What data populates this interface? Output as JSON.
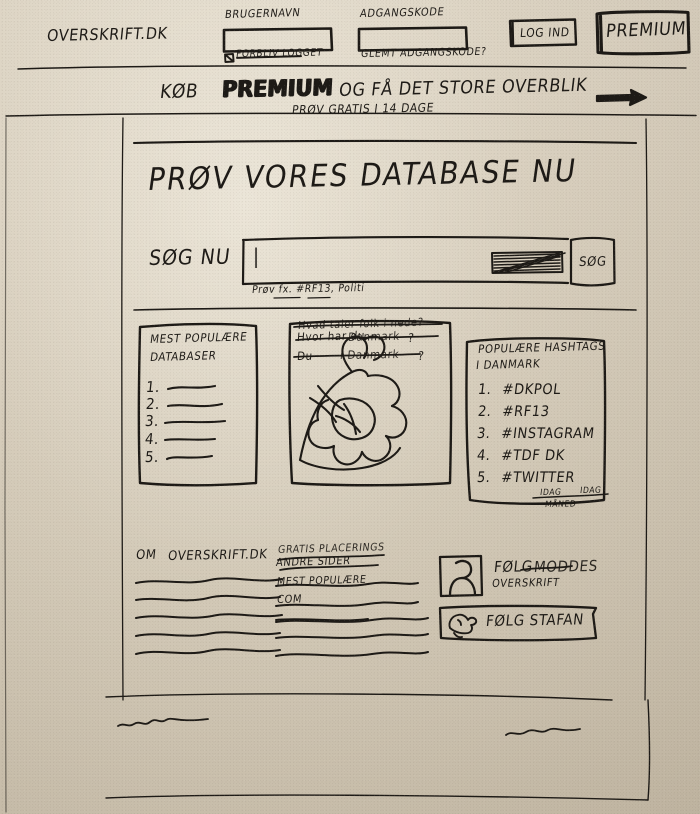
{
  "meta": {
    "kind": "hand-drawn website wireframe sketch",
    "language": "Danish",
    "ink_color": "#1d1a16",
    "paper_color": "#d3c9b7"
  },
  "header": {
    "logo": "OVERSKRIFT.DK",
    "username_label": "BRUGERNAVN",
    "username_value": "",
    "password_label": "ADGANGSKODE",
    "password_value": "",
    "remember_checkbox_label": "FORBLIV LOGGET",
    "forgot_link": "GLEMT ADGANGSKODE?",
    "login_button": "LOG IND",
    "premium_button": "PREMIUM"
  },
  "banner": {
    "text_before": "KØB",
    "text_bold": "PREMIUM",
    "text_after": "OG FÅ DET STORE OVERBLIK",
    "subtext": "PRØV GRATIS I 14 DAGE",
    "arrow_icon": "arrow-right-icon"
  },
  "hero": {
    "title": "PRØV VORES DATABASE NU",
    "search_label": "SØG NU",
    "search_value": "|",
    "search_placeholder": "",
    "search_button": "SØG",
    "search_hint": "Prøv fx. #RF13, Politi",
    "scribble_icon": "scribble-block-icon"
  },
  "cards": {
    "popular_databases": {
      "title_line1": "MEST POPULÆRE",
      "title_line2": "DATABASER",
      "items": [
        "1.",
        "2.",
        "3.",
        "4.",
        "5."
      ],
      "item_placeholder": "squiggle-line"
    },
    "talk_box": {
      "line1_struck": "Hvad taler folk i nede?",
      "line2": "Hvor har du",
      "line2_struck": "Danmark",
      "line2_tail": "?",
      "line3_before": "Du",
      "line3_struck": "i Danmark",
      "line3_tail": "?",
      "illustration_icon": "denmark-map-hand-sketch-icon"
    },
    "popular_hashtags": {
      "title": "POPULÆRE HASHTAGS",
      "subtitle": "I DANMARK",
      "items": [
        {
          "rank": "1.",
          "tag": "#DKPOL"
        },
        {
          "rank": "2.",
          "tag": "#RF13"
        },
        {
          "rank": "3.",
          "tag": "#INSTAGRAM"
        },
        {
          "rank": "4.",
          "tag": "#TDF DK"
        },
        {
          "rank": "5.",
          "tag": "#TWITTER"
        }
      ],
      "range_today": "IDAG",
      "range_week": "IDAG",
      "range_month": "MÅNED"
    }
  },
  "footer": {
    "col_about": {
      "title_before": "OM",
      "title_link": "OVERSKRIFT.DK",
      "lines": 5
    },
    "col_links": {
      "title_struck": "GRATIS PLACERINGS",
      "title_line2": "ANDRE SIDER",
      "subtitle": "MEST POPULÆRE",
      "subtitle2": "COM",
      "lines": 3
    },
    "col_social": {
      "facebook_label": "FØLG",
      "facebook_struck": "MODDES",
      "facebook_label2": "OVERSKRIFT",
      "avatar_icon": "facebook-avatar-icon",
      "twitter_button": "FØLG STAFAN",
      "twitter_icon": "twitter-bird-icon"
    },
    "bottom_left_squiggle": "squiggle-line",
    "bottom_right_squiggle": "squiggle-line"
  }
}
